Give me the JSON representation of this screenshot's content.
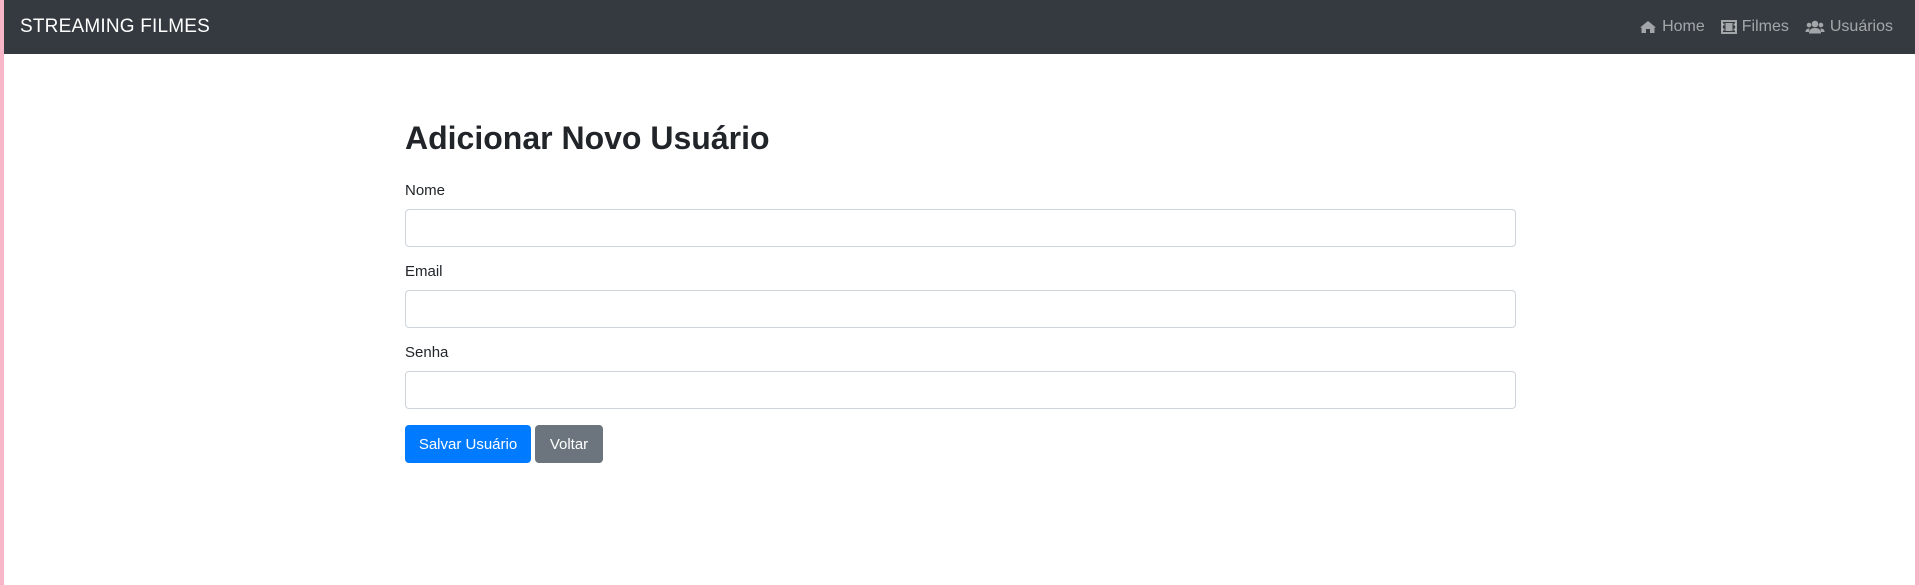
{
  "navbar": {
    "brand": "STREAMING FILMES",
    "links": [
      {
        "label": "Home",
        "icon": "home-icon"
      },
      {
        "label": "Filmes",
        "icon": "film-icon"
      },
      {
        "label": "Usuários",
        "icon": "users-icon"
      }
    ]
  },
  "form": {
    "title": "Adicionar Novo Usuário",
    "fields": [
      {
        "label": "Nome",
        "value": "",
        "placeholder": ""
      },
      {
        "label": "Email",
        "value": "",
        "placeholder": ""
      },
      {
        "label": "Senha",
        "value": "",
        "placeholder": ""
      }
    ],
    "save_label": "Salvar Usuário",
    "back_label": "Voltar"
  },
  "colors": {
    "navbar_bg": "#343a40",
    "primary": "#007bff",
    "secondary": "#6c757d"
  }
}
